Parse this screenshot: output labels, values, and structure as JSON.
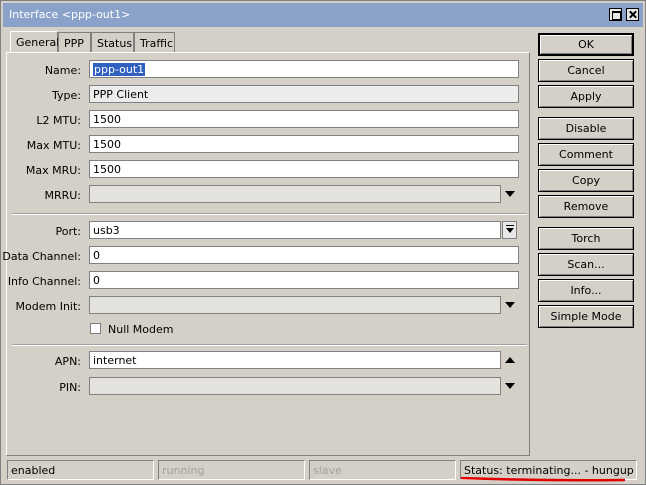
{
  "window": {
    "title": "Interface <ppp-out1>"
  },
  "tabs": [
    {
      "label": "General",
      "active": true
    },
    {
      "label": "PPP",
      "active": false
    },
    {
      "label": "Status",
      "active": false
    },
    {
      "label": "Traffic",
      "active": false
    }
  ],
  "form": {
    "name_label": "Name:",
    "name_value": "ppp-out1",
    "type_label": "Type:",
    "type_value": "PPP Client",
    "l2mtu_label": "L2 MTU:",
    "l2mtu_value": "1500",
    "maxmtu_label": "Max MTU:",
    "maxmtu_value": "1500",
    "maxmru_label": "Max MRU:",
    "maxmru_value": "1500",
    "mrru_label": "MRRU:",
    "mrru_value": "",
    "port_label": "Port:",
    "port_value": "usb3",
    "data_channel_label": "Data Channel:",
    "data_channel_value": "0",
    "info_channel_label": "Info Channel:",
    "info_channel_value": "0",
    "modem_init_label": "Modem Init:",
    "modem_init_value": "",
    "null_modem_label": "Null Modem",
    "null_modem_checked": false,
    "apn_label": "APN:",
    "apn_value": "internet",
    "pin_label": "PIN:",
    "pin_value": ""
  },
  "buttons": {
    "ok": "OK",
    "cancel": "Cancel",
    "apply": "Apply",
    "disable": "Disable",
    "comment": "Comment",
    "copy": "Copy",
    "remove": "Remove",
    "torch": "Torch",
    "scan": "Scan...",
    "info": "Info...",
    "simple_mode": "Simple Mode"
  },
  "status": {
    "enabled": "enabled",
    "running": "running",
    "slave": "slave",
    "status_text": "Status: terminating... - hungup"
  },
  "colors": {
    "titlebar": "#8aa2ca",
    "selection": "#3060c0",
    "annotation": "#e00000"
  }
}
